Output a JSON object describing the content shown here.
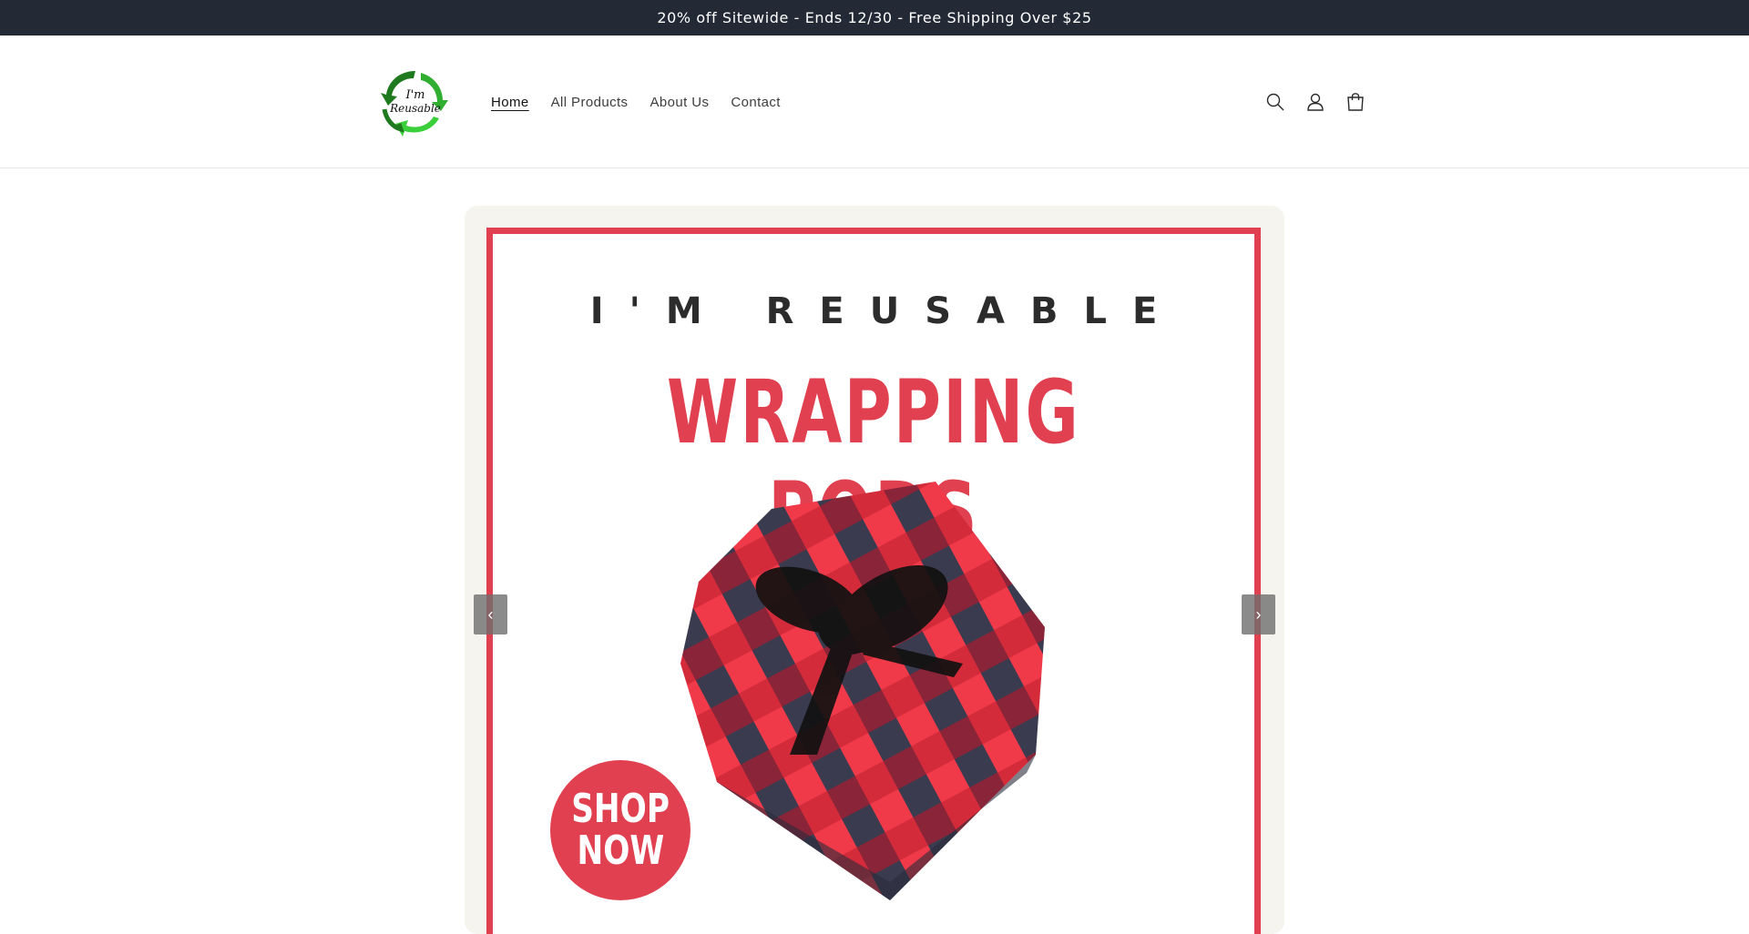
{
  "announcement": {
    "text": "20% off Sitewide - Ends 12/30 - Free Shipping Over $25"
  },
  "header": {
    "logo_text_line1": "I'm",
    "logo_text_line2": "Reusable",
    "nav": [
      {
        "label": "Home",
        "active": true
      },
      {
        "label": "All Products",
        "active": false
      },
      {
        "label": "About Us",
        "active": false
      },
      {
        "label": "Contact",
        "active": false
      }
    ],
    "icons": [
      "search-icon",
      "account-icon",
      "cart-icon"
    ]
  },
  "slideshow": {
    "prev_label": "‹",
    "next_label": "›",
    "slide": {
      "subtitle": "I'M REUSABLE",
      "title": "WRAPPING PODS",
      "cta_line1": "SHOP",
      "cta_line2": "NOW"
    }
  },
  "colors": {
    "announcement_bg": "#232a36",
    "accent_red": "#e0404f",
    "logo_green_dark": "#1f7a1f",
    "logo_green_light": "#3ccf3c"
  }
}
